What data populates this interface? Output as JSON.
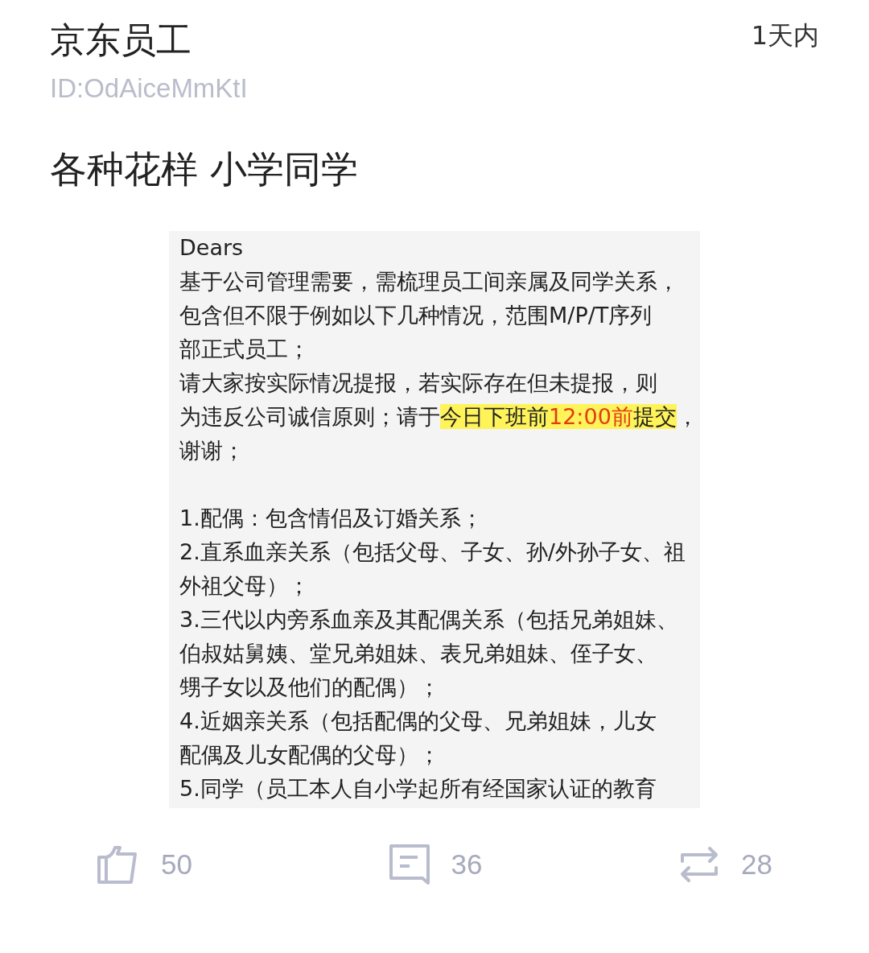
{
  "post": {
    "author": "京东员工",
    "user_id": "ID:OdAiceMmKtI",
    "time": "1天内",
    "text": "各种花样 小学同学"
  },
  "document": {
    "paragraphs": [
      [
        "Dears",
        "基于公司管理需要，需梳理员工间亲属及同学关系，",
        "包含但不限于例如以下几种情况，范围M/P/T序列",
        "部正式员工；",
        "请大家按实际情况提报，若实际存在但未提报，则",
        [
          {
            "text": "为违反公司诚信原则；请于",
            "kind": "plain"
          },
          {
            "text": "今日下班前",
            "kind": "marked"
          },
          {
            "text": "12:00前",
            "kind": "marked-red"
          },
          {
            "text": "提交",
            "kind": "marked"
          },
          {
            "text": "，",
            "kind": "plain"
          }
        ],
        "谢谢；"
      ],
      [
        "1.配偶：包含情侣及订婚关系；",
        "2.直系血亲关系（包括父母、子女、孙/外孙子女、祖",
        "外祖父母）；",
        "3.三代以内旁系血亲及其配偶关系（包括兄弟姐妹、",
        "伯叔姑舅姨、堂兄弟姐妹、表兄弟姐妹、侄子女、",
        "甥子女以及他们的配偶）；",
        "4.近姻亲关系（包括配偶的父母、兄弟姐妹，儿女",
        "配偶及儿女配偶的父母）；",
        "5.同学（员工本人自小学起所有经国家认证的教育"
      ]
    ]
  },
  "actions": [
    {
      "kind": "like",
      "count": "50"
    },
    {
      "kind": "comment",
      "count": "36"
    },
    {
      "kind": "repost",
      "count": "28"
    }
  ]
}
